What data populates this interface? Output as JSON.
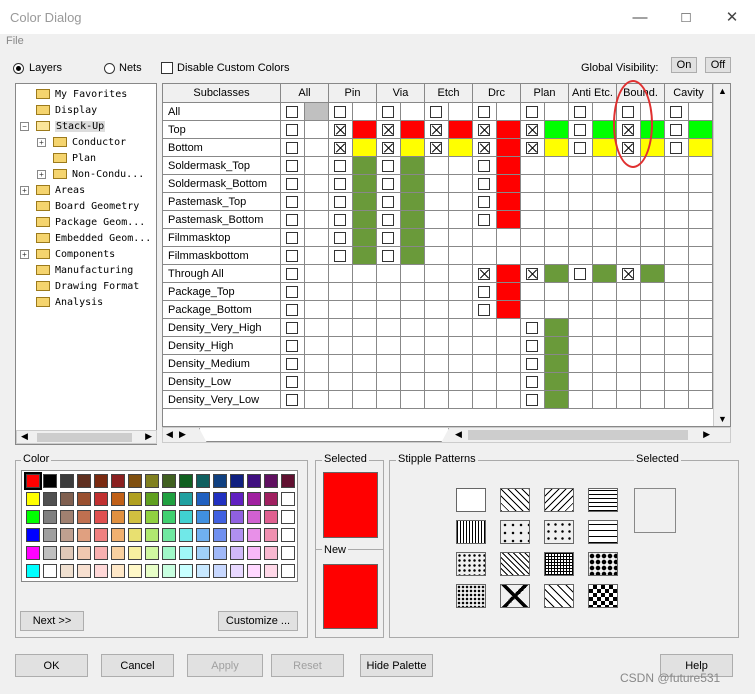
{
  "window": {
    "title": "Color Dialog",
    "menu_file": "File"
  },
  "top": {
    "layers_label": "Layers",
    "nets_label": "Nets",
    "disable_custom_label": "Disable Custom Colors",
    "global_visibility_label": "Global Visibility:",
    "on_label": "On",
    "off_label": "Off"
  },
  "tree": [
    {
      "label": "My Favorites",
      "indent": 0
    },
    {
      "label": "Display",
      "indent": 0
    },
    {
      "label": "Stack-Up",
      "indent": 0,
      "expanded": true
    },
    {
      "label": "Conductor",
      "indent": 1,
      "expander": "+"
    },
    {
      "label": "Plan",
      "indent": 1
    },
    {
      "label": "Non-Condu...",
      "indent": 1,
      "expander": "+"
    },
    {
      "label": "Areas",
      "indent": 0,
      "expander": "+"
    },
    {
      "label": "Board Geometry",
      "indent": 0
    },
    {
      "label": "Package Geom...",
      "indent": 0
    },
    {
      "label": "Embedded Geom...",
      "indent": 0
    },
    {
      "label": "Components",
      "indent": 0,
      "expander": "+"
    },
    {
      "label": "Manufacturing",
      "indent": 0
    },
    {
      "label": "Drawing Format",
      "indent": 0
    },
    {
      "label": "Analysis",
      "indent": 0
    }
  ],
  "grid": {
    "subclasses_header": "Subclasses",
    "columns": [
      "All",
      "Pin",
      "Via",
      "Etch",
      "Drc",
      "Plan",
      "Anti Etc.",
      "Bound.",
      "Cavity"
    ],
    "rows": [
      "All",
      "Top",
      "Bottom",
      "Soldermask_Top",
      "Soldermask_Bottom",
      "Pastemask_Top",
      "Pastemask_Bottom",
      "Filmmasktop",
      "Filmmaskbottom",
      "Through All",
      "Package_Top",
      "Package_Bottom",
      "Density_Very_High",
      "Density_High",
      "Density_Medium",
      "Density_Low",
      "Density_Very_Low"
    ],
    "colors": {
      "red": "#ff0000",
      "yellow": "#ffff00",
      "green": "#00ff00",
      "olive": "#6a9a3a",
      "gray": "#c0c0c0"
    }
  },
  "color_panel": {
    "color_label": "Color",
    "next_label": "Next >>",
    "customize_label": "Customize ...",
    "selected_label": "Selected",
    "new_label": "New",
    "selected_color": "#ff0000",
    "new_color": "#ff0000",
    "palette": [
      [
        "#ff0000",
        "#000000",
        "#3c3c3c",
        "#603020",
        "#7a2a10",
        "#8a2020",
        "#805010",
        "#808020",
        "#406020",
        "#106020",
        "#106060",
        "#104080",
        "#102080",
        "#401080",
        "#601060",
        "#601030"
      ],
      [
        "#ffff00",
        "#505050",
        "#806050",
        "#9a5030",
        "#c03030",
        "#c06018",
        "#b0a020",
        "#60a020",
        "#20a040",
        "#20a0a0",
        "#2060c0",
        "#2030c0",
        "#6020c0",
        "#a020a0",
        "#a02060",
        "#ffffff"
      ],
      [
        "#00ff00",
        "#808080",
        "#a08070",
        "#c07050",
        "#e05050",
        "#e09040",
        "#d0c040",
        "#90d040",
        "#40d070",
        "#40d0d0",
        "#4090e0",
        "#4060e0",
        "#9060e0",
        "#d060d0",
        "#e06090",
        "#ffffff"
      ],
      [
        "#0000ff",
        "#a0a0a0",
        "#c0a090",
        "#e0a080",
        "#f08080",
        "#f0b070",
        "#e8e070",
        "#b0e870",
        "#70e8a0",
        "#70e8e8",
        "#70b0f0",
        "#7090f0",
        "#b090f0",
        "#e890e8",
        "#f090b0",
        "#ffffff"
      ],
      [
        "#ff00ff",
        "#c0c0c0",
        "#e0c8b8",
        "#f0c8b0",
        "#f8b0b0",
        "#f8d0a0",
        "#f8f0a0",
        "#d0f8a0",
        "#a0f8c8",
        "#a0f8f8",
        "#a0d0f8",
        "#a0b8f8",
        "#d0b8f8",
        "#f8b8f8",
        "#f8b8d0",
        "#ffffff"
      ],
      [
        "#00ffff",
        "#ffffff",
        "#f0e0d0",
        "#f8e0d0",
        "#ffd8d8",
        "#ffe8c8",
        "#fff8c8",
        "#e8ffc8",
        "#c8ffe0",
        "#c8ffff",
        "#c8e8ff",
        "#c8d8ff",
        "#e8d8ff",
        "#ffd8ff",
        "#ffd8e8",
        "#ffffff"
      ]
    ]
  },
  "stipple": {
    "label": "Stipple Patterns",
    "selected_label": "Selected"
  },
  "footer": {
    "ok": "OK",
    "cancel": "Cancel",
    "apply": "Apply",
    "reset": "Reset",
    "hide_palette": "Hide Palette",
    "help": "Help"
  },
  "watermark": "CSDN @future531"
}
